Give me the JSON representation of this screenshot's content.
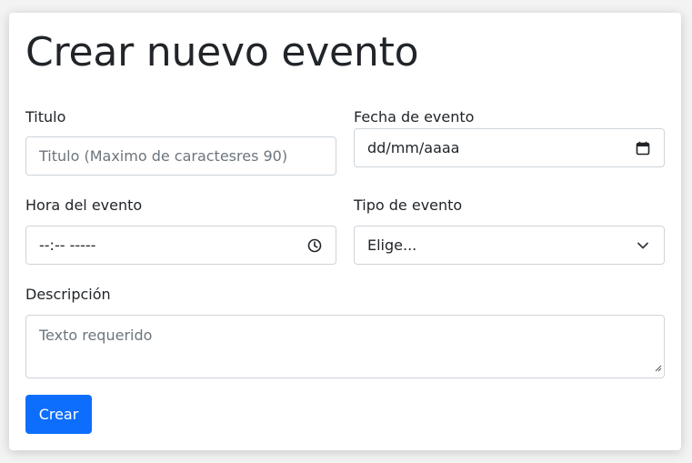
{
  "form": {
    "heading": "Crear nuevo evento",
    "title_label": "Titulo",
    "title_placeholder": "Titulo (Maximo de caractesres 90)",
    "date_label": "Fecha de evento",
    "date_value": "dd/mm/aaaa",
    "time_label": "Hora del evento",
    "time_value": "--:-- -----",
    "type_label": "Tipo de evento",
    "type_selected": "Elige...",
    "description_label": "Descripción",
    "description_placeholder": "Texto requerido",
    "submit_label": "Crear"
  },
  "colors": {
    "primary": "#0d6efd",
    "border": "#ced4da",
    "placeholder": "#6c757d",
    "text": "#212529"
  },
  "icons": {
    "date": "calendar-icon",
    "time": "clock-icon",
    "select": "chevron-down-icon",
    "textarea": "resize-grip-icon"
  }
}
